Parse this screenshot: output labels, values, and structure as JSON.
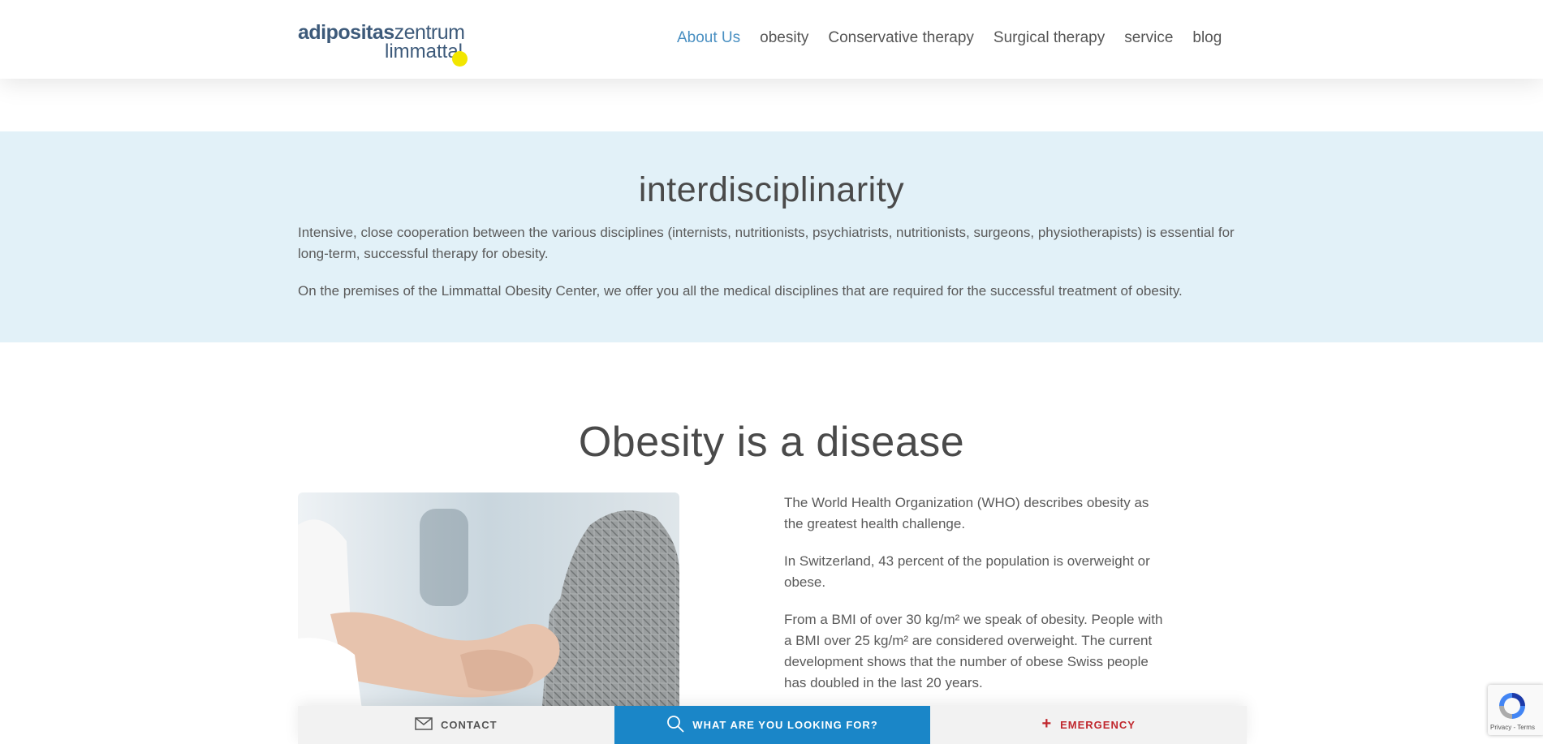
{
  "header": {
    "logo": {
      "part1": "adipositas",
      "part2": "zentrum",
      "part3": "limmattal"
    },
    "nav": [
      {
        "label": "About Us",
        "active": true
      },
      {
        "label": "obesity",
        "active": false
      },
      {
        "label": "Conservative therapy",
        "active": false
      },
      {
        "label": "Surgical therapy",
        "active": false
      },
      {
        "label": "service",
        "active": false
      },
      {
        "label": "blog",
        "active": false
      }
    ]
  },
  "interdisciplinarity": {
    "title": "interdisciplinarity",
    "p1": "Intensive, close cooperation between the various disciplines (internists, nutritionists, psychiatrists, nutritionists, surgeons, physiotherapists) is essential for long-term, successful therapy for obesity.",
    "p2": "On the premises of the Limmattal Obesity Center, we offer you all the medical disciplines that are required for the successful treatment of obesity."
  },
  "obesity": {
    "title": "Obesity is a disease",
    "p1": "The World Health Organization (WHO) describes obesity as the greatest health challenge.",
    "p2": "In Switzerland, 43 percent of the population is overweight or obese.",
    "p3": "From a BMI of over 30 kg/m² we speak of obesity. People with a BMI over 25 kg/m² are considered overweight. The current development shows that the number of obese Swiss people has doubled in the last 20 years."
  },
  "bottombar": {
    "contact": "CONTACT",
    "search": "WHAT ARE YOU LOOKING FOR?",
    "emergency": "EMERGENCY"
  },
  "recaptcha": {
    "text": "Privacy - Terms"
  },
  "colors": {
    "accent": "#4a90c2",
    "band": "#e2f1f8",
    "search_bar": "#1a86c8",
    "emergency": "#c0272d",
    "logo_dot": "#f2e600"
  },
  "icons": {
    "contact": "envelope-icon",
    "search": "search-icon",
    "emergency": "plus-icon"
  }
}
